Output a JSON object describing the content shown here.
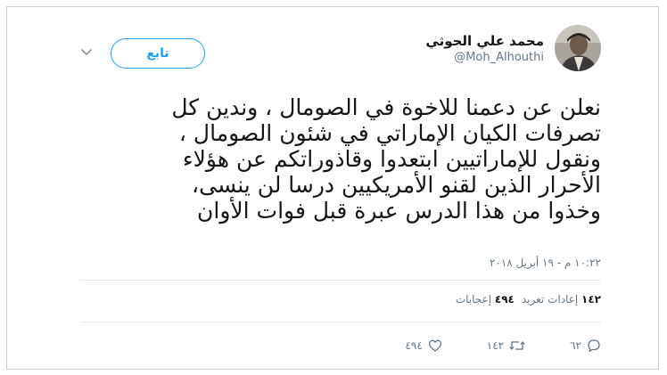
{
  "tweet": {
    "display_name": "محمد علي الحوثي",
    "handle": "@Moh_Alhouthi",
    "follow_label": "تابع",
    "text_lines": [
      "نعلن عن دعمنا للاخوة في الصومال ، وندين كل",
      "تصرفات الكيان الإماراتي في شئون الصومال ،",
      "ونقول للإماراتيين ابتعدوا وقاذوراتكم عن هؤلاء",
      "الأحرار الذين لقنو الأمريكيين درسا لن ينسى،",
      "وخذوا من هذا الدرس عبرة قبل فوات الأوان"
    ],
    "timestamp": "١٠:٢٢ م - ١٩ أبريل ٢٠١٨",
    "stats": {
      "retweets_count": "١٤٢",
      "retweets_label": "إعادات تغريد",
      "likes_count": "٤٩٤",
      "likes_label": "إعجابات"
    },
    "actions": {
      "reply_count": "٦٢",
      "retweet_count": "١٤٢",
      "like_count": "٤٩٤"
    }
  },
  "colors": {
    "accent": "#1da1f2",
    "text": "#14171a",
    "muted": "#657786"
  },
  "icons": [
    "chevron-down-icon",
    "reply-icon",
    "retweet-icon",
    "heart-icon"
  ]
}
